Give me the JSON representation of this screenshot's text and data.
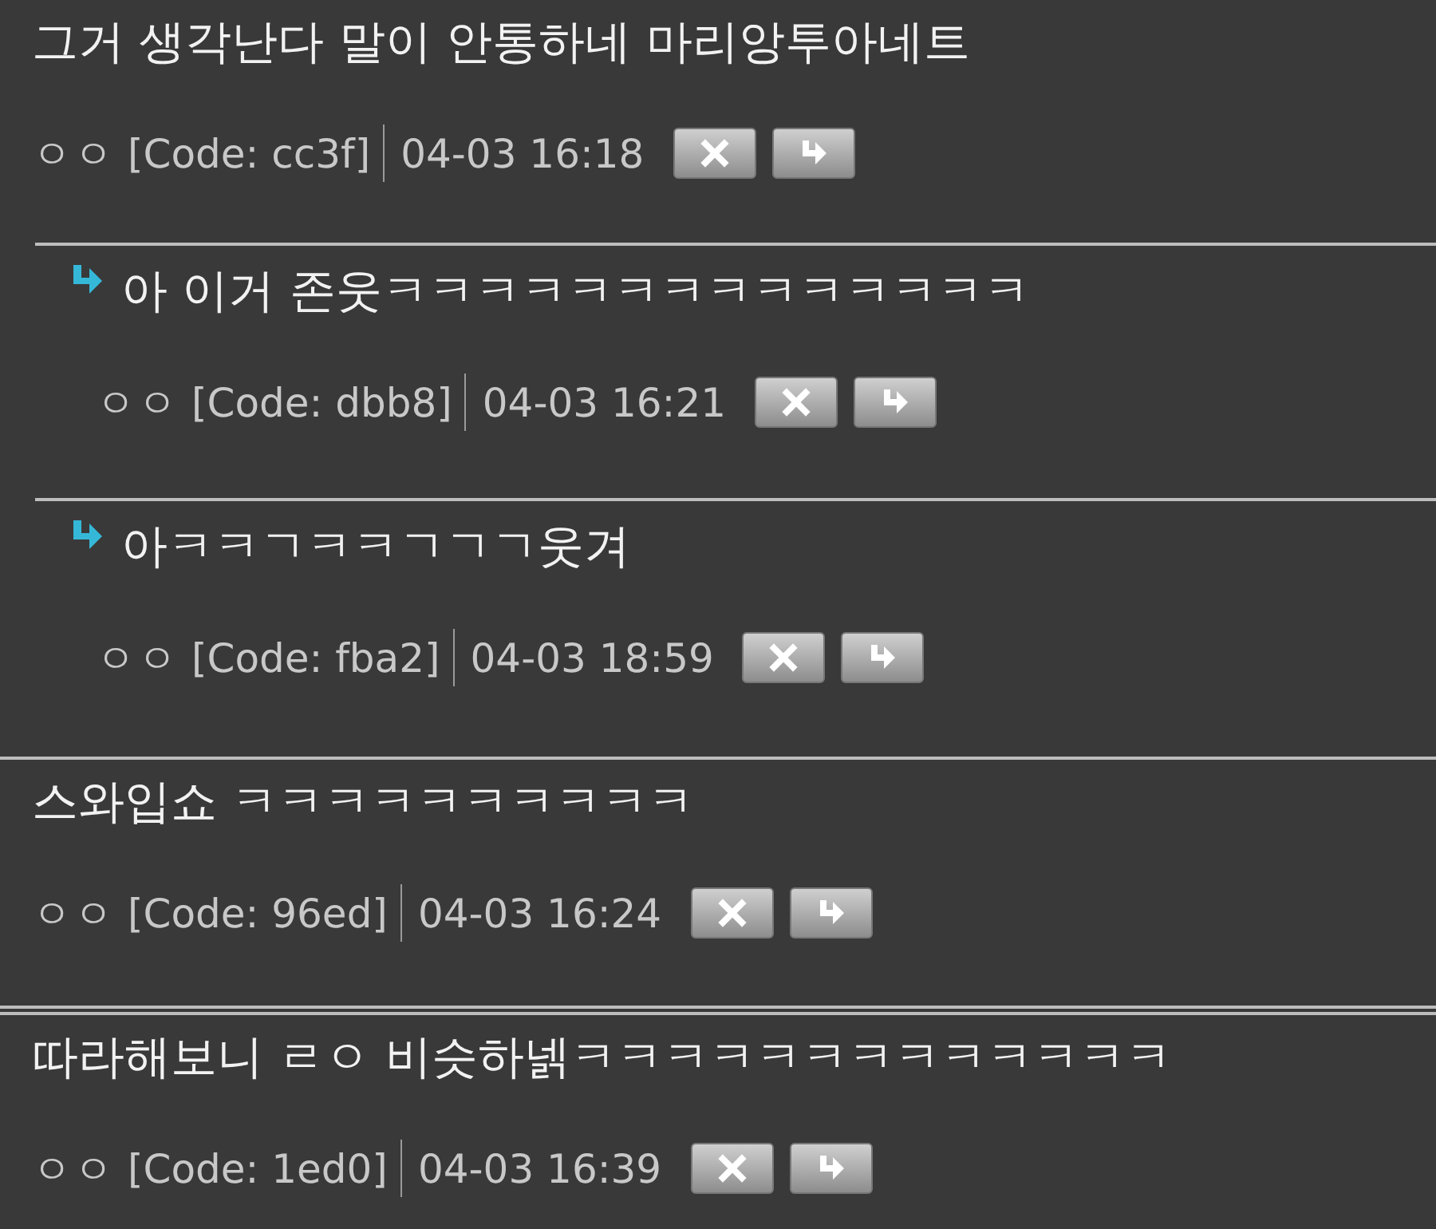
{
  "comments": [
    {
      "text": "그거 생각난다 말이 안통하네 마리앙투아네트",
      "author": "ㅇㅇ",
      "code": "[Code: cc3f]",
      "time": "04-03 16:18",
      "replies": [
        {
          "text": "아 이거 존웃ㅋㅋㅋㅋㅋㅋㅋㅋㅋㅋㅋㅋㅋㅋ",
          "author": "ㅇㅇ",
          "code": "[Code: dbb8]",
          "time": "04-03 16:21"
        },
        {
          "text": "아ㅋㅋㄱㅋㅋㄱㄱㄱ웃겨",
          "author": "ㅇㅇ",
          "code": "[Code: fba2]",
          "time": "04-03 18:59"
        }
      ]
    },
    {
      "text": "스와입쇼 ㅋㅋㅋㅋㅋㅋㅋㅋㅋㅋ",
      "author": "ㅇㅇ",
      "code": "[Code: 96ed]",
      "time": "04-03 16:24"
    },
    {
      "text": "따라해보니 ㄹㅇ 비슷하넭ㅋㅋㅋㅋㅋㅋㅋㅋㅋㅋㅋㅋㅋ",
      "author": "ㅇㅇ",
      "code": "[Code: 1ed0]",
      "time": "04-03 16:39"
    }
  ]
}
